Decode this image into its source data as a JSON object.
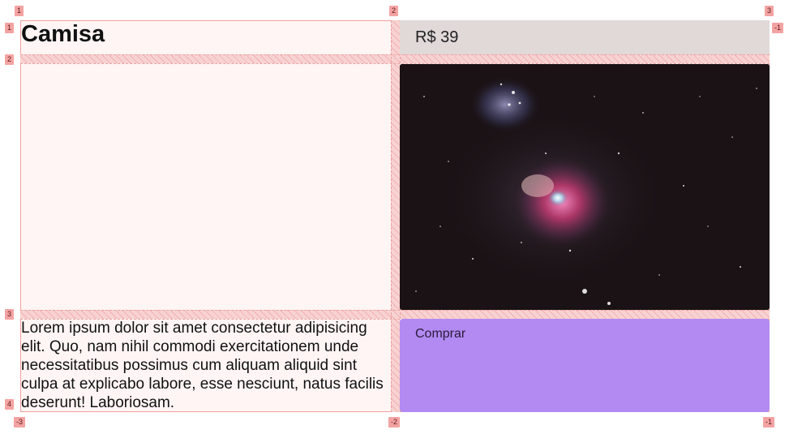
{
  "product": {
    "title": "Camisa",
    "price": "R$ 39",
    "description": "Lorem ipsum dolor sit amet consectetur adipisicing elit. Quo, nam nihil commodi exercitationem unde necessitatibus possimus cum aliquam aliquid sint culpa at explicabo labore, esse nesciunt, natus facilis deserunt! Laboriosam.",
    "buy_label": "Comprar",
    "image_icon": "nebula-image"
  },
  "grid_overlay": {
    "column_labels_top": [
      "1",
      "2",
      "3",
      "-1"
    ],
    "column_labels_bottom": [
      "-3",
      "-2",
      "-1"
    ],
    "row_labels": [
      "1",
      "2",
      "3",
      "4"
    ]
  },
  "colors": {
    "price_bg": "#e1d8d8",
    "buy_bg": "#b28af2",
    "grid_bg": "#fff5f4",
    "grid_line": "#f2a0a0"
  }
}
